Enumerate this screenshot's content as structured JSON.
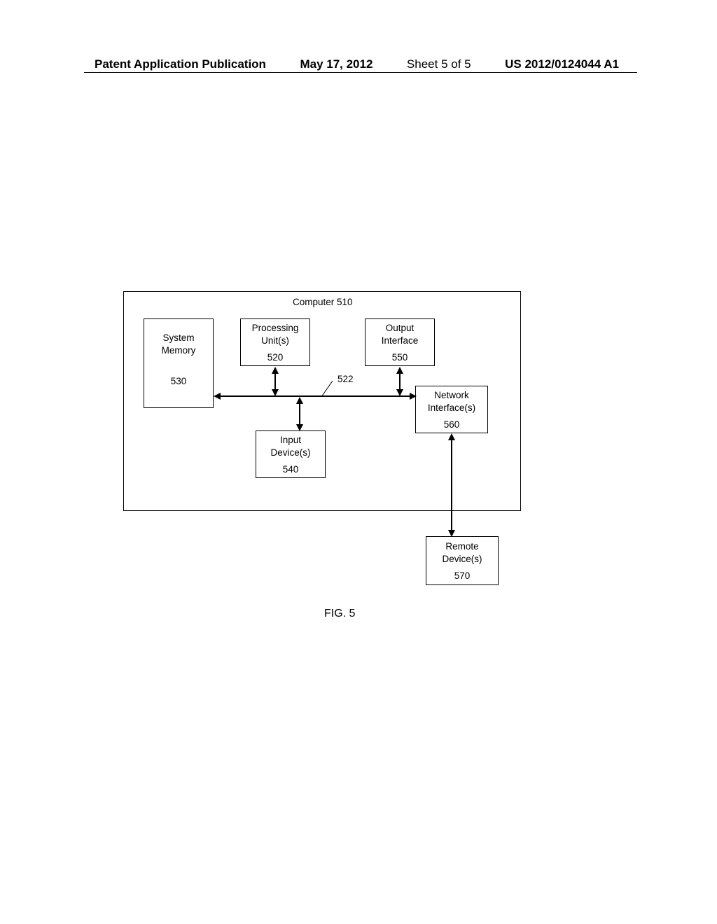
{
  "header": {
    "publication": "Patent Application Publication",
    "date": "May 17, 2012",
    "sheet": "Sheet 5 of 5",
    "patnum": "US 2012/0124044 A1"
  },
  "diagram": {
    "outer_label": "Computer 510",
    "blocks": {
      "system_memory": {
        "line1": "System",
        "line2": "Memory",
        "ref": "530"
      },
      "processing": {
        "line1": "Processing",
        "line2": "Unit(s)",
        "ref": "520"
      },
      "output": {
        "line1": "Output",
        "line2": "Interface",
        "ref": "550"
      },
      "input": {
        "line1": "Input",
        "line2": "Device(s)",
        "ref": "540"
      },
      "network": {
        "line1": "Network",
        "line2": "Interface(s)",
        "ref": "560"
      },
      "remote": {
        "line1": "Remote",
        "line2": "Device(s)",
        "ref": "570"
      }
    },
    "bus_ref": "522",
    "figure_caption": "FIG. 5"
  }
}
